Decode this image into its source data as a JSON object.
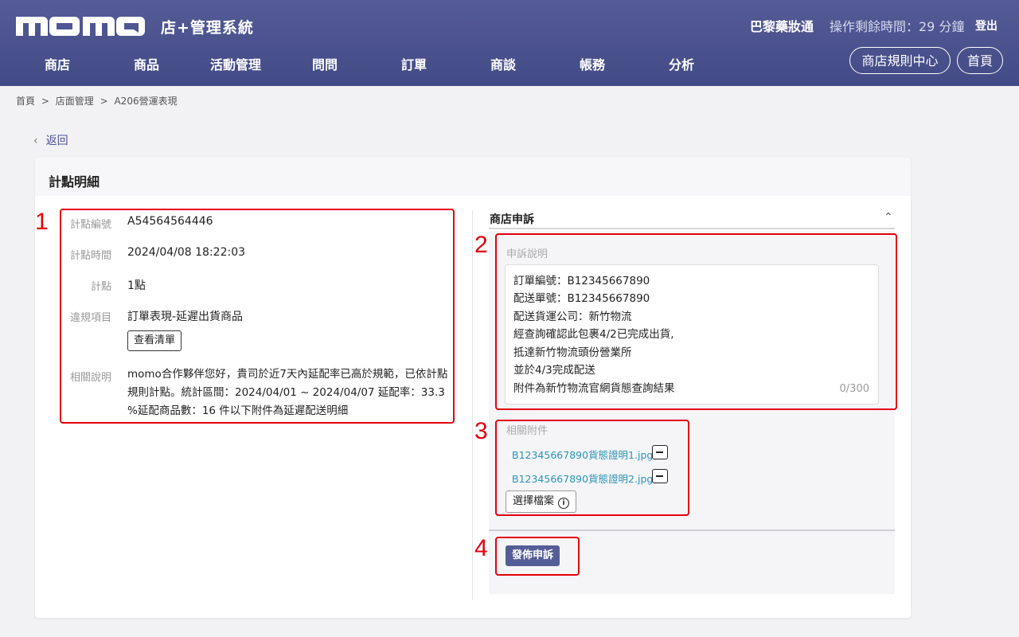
{
  "header": {
    "logo_text": "momo",
    "system_title": "店+管理系統",
    "shop_name": "巴黎藥妝通",
    "session_timer": "操作剩餘時間：29 分鐘",
    "logout_label": "登出",
    "nav": [
      "商店",
      "商品",
      "活動管理",
      "問問",
      "訂單",
      "商談",
      "帳務",
      "分析"
    ],
    "rules_center_label": "商店規則中心",
    "home_label": "首頁"
  },
  "breadcrumb": [
    "首頁",
    ">",
    "店面管理",
    ">",
    "A206營運表現"
  ],
  "back_label": "返回",
  "card": {
    "title": "計點明細",
    "details": {
      "id_label": "計點編號",
      "id_value": "A54564564446",
      "time_label": "計點時間",
      "time_value": "2024/04/08 18:22:03",
      "points_label": "計點",
      "points_value": "1點",
      "violation_label": "違規項目",
      "violation_value": "訂單表現-延遲出貨商品",
      "view_list_label": "查看清單",
      "note_label": "相關說明",
      "note_value": "momo合作夥伴您好，貴司於近7天內延配率已高於規範，已依計點規則計點。統計區間：2024/04/01 ~ 2024/04/07 延配率：33.3 %延配商品數：16 件以下附件為延遲配送明細"
    },
    "appeal": {
      "section_title": "商店申訴",
      "collapse_icon": "chevron-up-icon",
      "description_label": "申訴說明",
      "description_lines": [
        "訂單編號：B12345667890",
        "配送單號：B12345667890",
        "配送貨運公司：新竹物流",
        "經查詢確認此包裹4/2已完成出貨,",
        "抵達新竹物流頭份營業所",
        "並於4/3完成配送",
        "附件為新竹物流官網貨態查詢結果"
      ],
      "char_count": "0/300",
      "attachments_label": "相關附件",
      "attachments": [
        "B12345667890貨態證明1.jpg",
        "B12345667890貨態證明2.jpg"
      ],
      "choose_file_label": "選擇檔案",
      "info_icon": "info-icon",
      "submit_label": "發佈申訴"
    }
  },
  "annotations": [
    "1",
    "2",
    "3",
    "4"
  ],
  "colors": {
    "header_bg": "#4b5290",
    "accent": "#555d97",
    "annotation_red": "#e3000f",
    "link": "#2b94b5"
  }
}
